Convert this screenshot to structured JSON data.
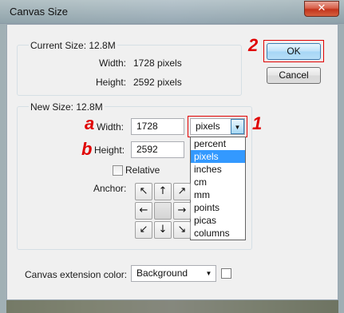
{
  "window": {
    "title": "Canvas Size",
    "close_glyph": "✕"
  },
  "current_size": {
    "label": "Current Size: 12.8M",
    "width_label": "Width:",
    "width_value": "1728 pixels",
    "height_label": "Height:",
    "height_value": "2592 pixels"
  },
  "buttons": {
    "ok": "OK",
    "cancel": "Cancel"
  },
  "new_size": {
    "label": "New Size: 12.8M",
    "width_label": "Width:",
    "width_value": "1728",
    "height_label": "Height:",
    "height_value": "2592",
    "unit_selected": "pixels",
    "unit_options": [
      "percent",
      "pixels",
      "inches",
      "cm",
      "mm",
      "points",
      "picas",
      "columns"
    ],
    "relative_label": "Relative",
    "anchor_label": "Anchor:",
    "anchor_glyphs": [
      "↖",
      "↑",
      "↗",
      "←",
      "",
      "→",
      "↙",
      "↓",
      "↘"
    ]
  },
  "extension": {
    "label": "Canvas extension color:",
    "value": "Background"
  },
  "annotations": {
    "mark_1": "1",
    "mark_2": "2",
    "mark_a": "a",
    "mark_b": "b"
  },
  "colors": {
    "accent_red": "#e00000",
    "selection_blue": "#3399ff"
  },
  "icons": {
    "dropdown_arrow": "▼"
  }
}
